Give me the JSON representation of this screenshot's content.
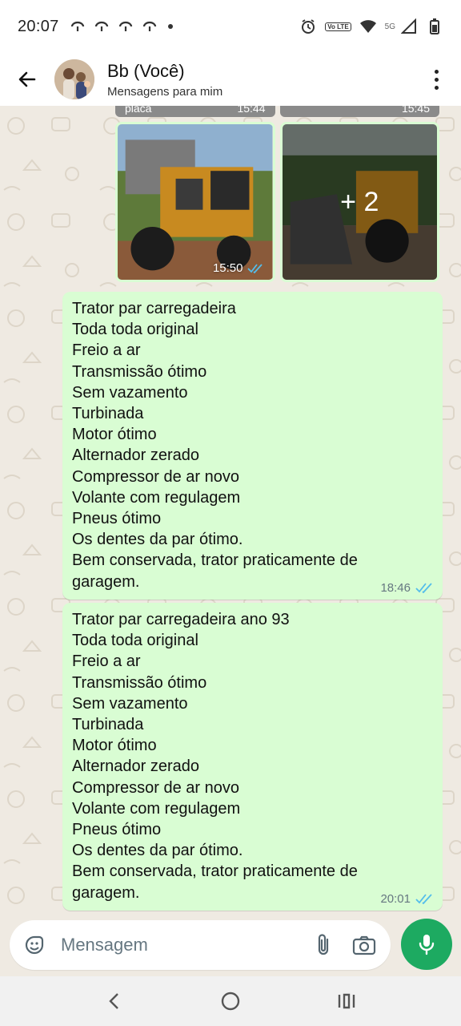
{
  "status_bar": {
    "time": "20:07",
    "left_icons": [
      "cloud-icon",
      "cloud-icon",
      "cloud-icon",
      "cloud-icon",
      "dot-icon"
    ],
    "right_icons": [
      "alarm-icon",
      "volte-icon",
      "wifi-icon",
      "signal-5g-icon",
      "signal-icon",
      "battery-icon"
    ],
    "volte_label": "Vo LTE",
    "network_label": "5G"
  },
  "header": {
    "contact_name": "Bb (Você)",
    "subtitle": "Mensagens para mim",
    "back_icon": "arrow-left-icon",
    "menu_icon": "more-vert-icon"
  },
  "chat": {
    "media_top": [
      {
        "caption": "placa",
        "time": "15:44"
      },
      {
        "caption": "",
        "time": "15:45"
      }
    ],
    "media_row": {
      "time": "15:50",
      "more_count": "+ 2"
    },
    "messages": [
      {
        "lines": [
          "Trator par carregadeira",
          "Toda toda original",
          "Freio a ar",
          "Transmissão ótimo",
          "Sem vazamento",
          "Turbinada",
          "Motor ótimo",
          "Alternador zerado",
          "Compressor de ar novo",
          "Volante com regulagem",
          "Pneus ótimo",
          "Os dentes da par ótimo.",
          "Bem conservada, trator praticamente de",
          "garagem."
        ],
        "time": "18:46",
        "status": "read"
      },
      {
        "lines": [
          "Trator par carregadeira ano 93",
          "Toda toda original",
          "Freio a ar",
          "Transmissão ótimo",
          "Sem vazamento",
          "Turbinada",
          "Motor ótimo",
          "Alternador zerado",
          "Compressor de ar novo",
          "Volante com regulagem",
          "Pneus ótimo",
          "Os dentes da par ótimo.",
          "Bem conservada, trator praticamente de",
          "garagem."
        ],
        "time": "20:01",
        "status": "read"
      }
    ]
  },
  "composer": {
    "placeholder": "Mensagem",
    "emoji_icon": "sticker-icon",
    "attach_icon": "paperclip-icon",
    "camera_icon": "camera-icon",
    "mic_icon": "microphone-icon"
  },
  "nav_bar": {
    "icons": [
      "back-nav-icon",
      "home-nav-icon",
      "recents-nav-icon"
    ]
  },
  "colors": {
    "bubble": "#d9fdd3",
    "chat_background": "#efeae2",
    "read_ticks": "#53bdeb",
    "mic_button": "#1daa61"
  }
}
